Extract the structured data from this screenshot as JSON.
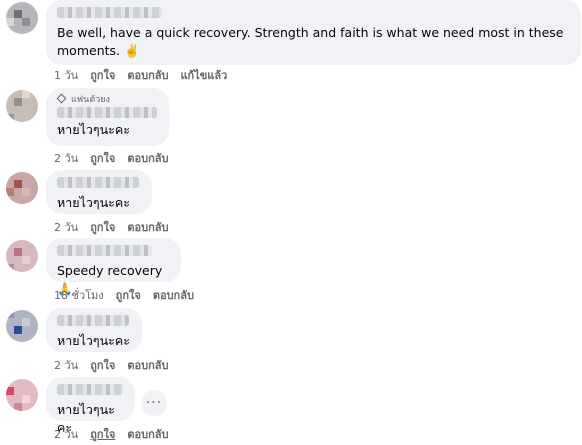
{
  "comments": [
    {
      "id": "c1",
      "text": "Be well, have a quick recovery. Strength and faith is what we need most in these moments. ✌️",
      "time": "1 วัน",
      "like": "ถูกใจ",
      "reply": "ตอบกลับ",
      "edited": "แก้ไขแล้ว"
    },
    {
      "id": "c2",
      "badge": "แฟนตัวยง",
      "text": "หายไวๆนะคะ",
      "time": "2 วัน",
      "like": "ถูกใจ",
      "reply": "ตอบกลับ"
    },
    {
      "id": "c3",
      "text": "หายไวๆนะคะ",
      "time": "2 วัน",
      "like": "ถูกใจ",
      "reply": "ตอบกลับ"
    },
    {
      "id": "c4",
      "text": "Speedy recovery 🙏",
      "time": "18 ชั่วโมง",
      "like": "ถูกใจ",
      "reply": "ตอบกลับ"
    },
    {
      "id": "c5",
      "text": "หายไวๆนะคะ",
      "time": "2 วัน",
      "like": "ถูกใจ",
      "reply": "ตอบกลับ"
    },
    {
      "id": "c6",
      "text": "หายไวๆนะคะ",
      "time": "2 วัน",
      "like": "ถูกใจ",
      "reply": "ตอบกลับ",
      "more": "···"
    }
  ],
  "colors": {
    "bubble": "#f0f2f5",
    "meta": "#65676b",
    "text": "#050505"
  },
  "icons": {
    "fan_badge": "diamond-icon",
    "more": "more-options-icon"
  }
}
